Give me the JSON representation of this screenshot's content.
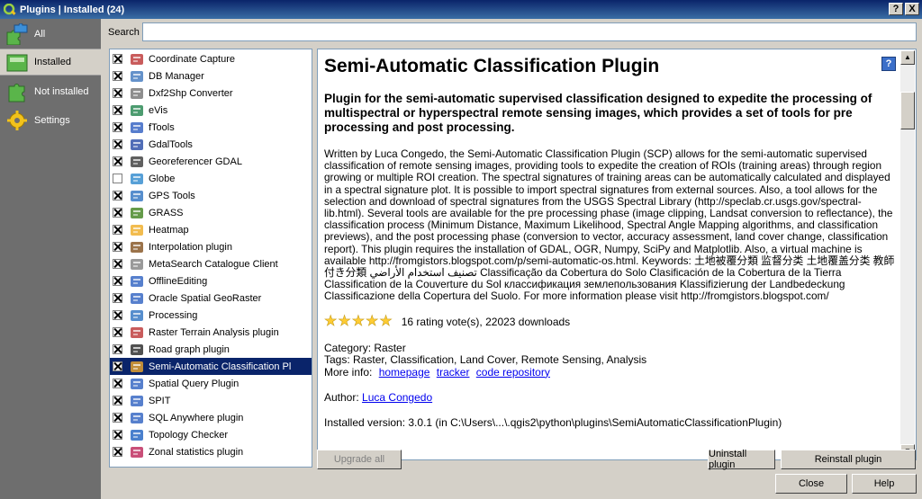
{
  "window": {
    "title": "Plugins | Installed (24)",
    "help_button": "?",
    "close_button": "X"
  },
  "nav": {
    "items": [
      {
        "label": "All",
        "icon": "puzzle-all-icon"
      },
      {
        "label": "Installed",
        "icon": "puzzle-installed-icon",
        "selected": true
      },
      {
        "label": "Not installed",
        "icon": "puzzle-not-installed-icon"
      },
      {
        "label": "Settings",
        "icon": "gear-icon"
      }
    ]
  },
  "search": {
    "label": "Search",
    "value": ""
  },
  "plugins": [
    {
      "label": "Coordinate Capture",
      "checked": true,
      "icon": "crosshair-icon"
    },
    {
      "label": "DB Manager",
      "checked": true,
      "icon": "database-icon"
    },
    {
      "label": "Dxf2Shp Converter",
      "checked": true,
      "icon": "convert-icon"
    },
    {
      "label": "eVis",
      "checked": true,
      "icon": "evis-icon"
    },
    {
      "label": "fTools",
      "checked": true,
      "icon": "ftools-icon"
    },
    {
      "label": "GdalTools",
      "checked": true,
      "icon": "gdal-icon"
    },
    {
      "label": "Georeferencer GDAL",
      "checked": true,
      "icon": "georef-icon"
    },
    {
      "label": "Globe",
      "checked": false,
      "icon": "globe-icon"
    },
    {
      "label": "GPS Tools",
      "checked": true,
      "icon": "gps-icon"
    },
    {
      "label": "GRASS",
      "checked": true,
      "icon": "grass-icon"
    },
    {
      "label": "Heatmap",
      "checked": true,
      "icon": "heatmap-icon"
    },
    {
      "label": "Interpolation plugin",
      "checked": true,
      "icon": "interpolation-icon"
    },
    {
      "label": "MetaSearch Catalogue Client",
      "checked": true,
      "icon": "csw-icon"
    },
    {
      "label": "OfflineEditing",
      "checked": true,
      "icon": "offline-icon"
    },
    {
      "label": "Oracle Spatial GeoRaster",
      "checked": true,
      "icon": "oracle-icon"
    },
    {
      "label": "Processing",
      "checked": true,
      "icon": "processing-gear-icon"
    },
    {
      "label": "Raster Terrain Analysis plugin",
      "checked": true,
      "icon": "terrain-icon"
    },
    {
      "label": "Road graph plugin",
      "checked": true,
      "icon": "road-icon"
    },
    {
      "label": "Semi-Automatic Classification Pl",
      "checked": true,
      "icon": "scp-icon",
      "selected": true
    },
    {
      "label": "Spatial Query Plugin",
      "checked": true,
      "icon": "spatial-query-icon"
    },
    {
      "label": "SPIT",
      "checked": true,
      "icon": "spit-icon"
    },
    {
      "label": "SQL Anywhere plugin",
      "checked": true,
      "icon": "sql-icon"
    },
    {
      "label": "Topology Checker",
      "checked": true,
      "icon": "topology-icon"
    },
    {
      "label": "Zonal statistics plugin",
      "checked": true,
      "icon": "zonal-icon"
    }
  ],
  "details": {
    "title": "Semi-Automatic Classification Plugin",
    "subtitle": "Plugin for the semi-automatic supervised classification designed to expedite the processing of multispectral or hyperspectral remote sensing images, which provides a set of tools for pre processing and post processing.",
    "description": "Written by Luca Congedo, the Semi-Automatic Classification Plugin (SCP) allows for the semi-automatic supervised classification of remote sensing images, providing tools to expedite the creation of ROIs (training areas) through region growing or multiple ROI creation. The spectral signatures of training areas can be automatically calculated and displayed in a spectral signature plot. It is possible to import spectral signatures from external sources. Also, a tool allows for the selection and download of spectral signatures from the USGS Spectral Library (http://speclab.cr.usgs.gov/spectral-lib.html). Several tools are available for the pre processing phase (image clipping, Landsat conversion to reflectance), the classification process (Minimum Distance, Maximum Likelihood, Spectral Angle Mapping algorithms, and classification previews), and the post processing phase (conversion to vector, accuracy assessment, land cover change, classification report). This plugin requires the installation of GDAL, OGR, Numpy, SciPy and Matplotlib. Also, a virtual machine is available http://fromgistors.blogspot.com/p/semi-automatic-os.html. Keywords: 土地被覆分類 监督分类 土地覆盖分类 教師付き分類 تصنيف استخدام الأراضي Classificação da Cobertura do Solo Clasificación de la Cobertura de la Tierra Classification de la Couverture du Sol классификация землепользования Klassifizierung der Landbedeckung Classificazione della Copertura del Suolo. For more information please visit http://fromgistors.blogspot.com/",
    "rating_stars": 5,
    "rating_text": "16 rating vote(s), 22023 downloads",
    "category_label": "Category: Raster",
    "tags_label": "Tags: Raster, Classification, Land Cover, Remote Sensing, Analysis",
    "more_info_label": "More info:",
    "links": [
      "homepage",
      "tracker",
      "code repository"
    ],
    "author_label": "Author:",
    "author_name": "Luca Congedo",
    "installed_version_partial": "Installed version: 3.0.1 (in C:\\Users\\...\\.qgis2\\python\\plugins\\SemiAutomaticClassificationPlugin)"
  },
  "buttons": {
    "upgrade_all": "Upgrade all",
    "uninstall": "Uninstall plugin",
    "reinstall": "Reinstall plugin",
    "close": "Close",
    "help": "Help"
  }
}
